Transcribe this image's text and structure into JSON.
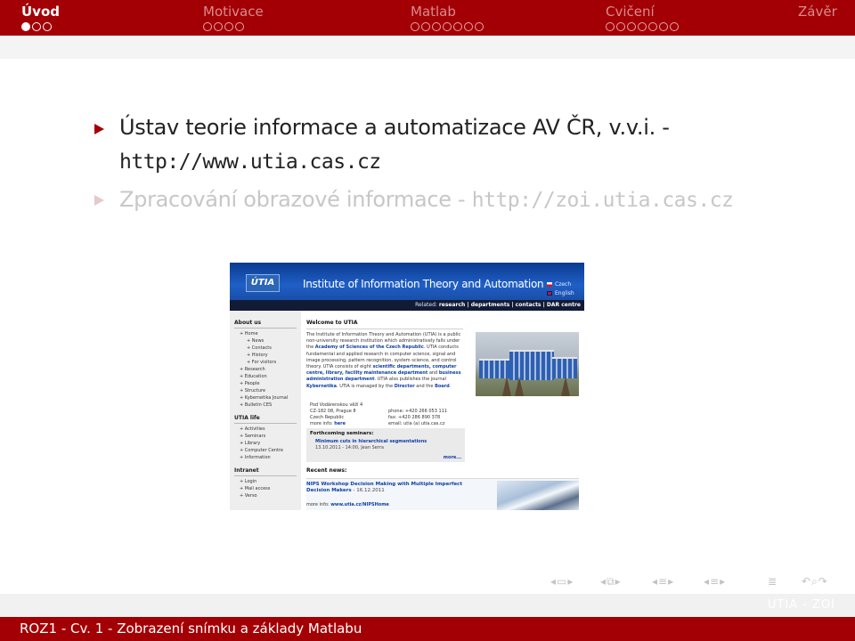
{
  "header": {
    "sections": [
      {
        "label": "Úvod",
        "dots_total": 3,
        "dots_filled": 1,
        "active": true
      },
      {
        "label": "Motivace",
        "dots_total": 4,
        "dots_filled": 0,
        "active": false
      },
      {
        "label": "Matlab",
        "dots_total": 7,
        "dots_filled": 0,
        "active": false
      },
      {
        "label": "Cvičení",
        "dots_total": 7,
        "dots_filled": 0,
        "active": false
      },
      {
        "label": "Závěr",
        "dots_total": 0,
        "dots_filled": 0,
        "active": false
      }
    ]
  },
  "slide": {
    "items": [
      {
        "text": "Ústav teorie informace a automatizace AV ČR, v.v.i. -",
        "url": "http://www.utia.cas.cz"
      },
      {
        "text": "Zpracování obrazové informace -",
        "url": "http://zoi.utia.cas.cz"
      }
    ]
  },
  "website": {
    "logo": "ÚTIA",
    "title": "Institute of Information Theory and Automation",
    "languages": [
      "Czech",
      "English"
    ],
    "related_prefix": "Related:",
    "related_links": "research | departments | contacts | DAR centre",
    "sidebar": {
      "about": {
        "heading": "About us",
        "links": [
          {
            "label": "+ Home",
            "level": "top"
          },
          {
            "label": "+ News",
            "level": "sub"
          },
          {
            "label": "+ Contacts",
            "level": "sub"
          },
          {
            "label": "+ History",
            "level": "sub"
          },
          {
            "label": "+ For visitors",
            "level": "sub"
          },
          {
            "label": "+ Research",
            "level": "top"
          },
          {
            "label": "+ Education",
            "level": "top"
          },
          {
            "label": "+ People",
            "level": "top"
          },
          {
            "label": "+ Structure",
            "level": "top"
          },
          {
            "label": "+ Kybernetika Journal",
            "level": "top"
          },
          {
            "label": "+ Bulletin CES",
            "level": "top"
          }
        ]
      },
      "life": {
        "heading": "UTIA life",
        "links": [
          {
            "label": "+ Activities",
            "level": "top"
          },
          {
            "label": "+ Seminars",
            "level": "top"
          },
          {
            "label": "+ Library",
            "level": "top"
          },
          {
            "label": "+ Computer Centre",
            "level": "top"
          },
          {
            "label": "+ Information",
            "level": "top"
          }
        ]
      },
      "intranet": {
        "heading": "Intranet",
        "links": [
          {
            "label": "+ Login",
            "level": "top"
          },
          {
            "label": "+ Mail access",
            "level": "top"
          },
          {
            "label": "+ Verso",
            "level": "top"
          }
        ]
      }
    },
    "welcome": "Welcome to UTIA",
    "intro_1": "The Institute of Information Theory and Automation (UTIA) is a public non-university research institution which administratively falls under the ",
    "intro_link_1": "Academy of Sciences of the Czech Republic",
    "intro_2": ". UTIA conducts fundamental and applied research in computer science, signal and image processing, pattern recognition, system science, and control theory. UTIA consists of eight ",
    "intro_link_2": "scientific departments, computer centre, library, facility maintenance department",
    "intro_3": " and ",
    "intro_link_3": "business administration department",
    "intro_4": ". UTIA also publishes the journal ",
    "intro_link_4": "Kybernetika",
    "intro_5": ". UTIA is managed by the ",
    "intro_link_5": "Director",
    "intro_6": " and the ",
    "intro_link_6": "Board",
    "intro_7": ".",
    "address": {
      "line1": "Pod Vodárenskou věží 4",
      "line2": "CZ-182 08, Prague 8",
      "line3": "Czech Republic",
      "more_prefix": "more info: ",
      "more_link": "here"
    },
    "contact": {
      "phone": "phone: +420 266 053 111",
      "fax": "fax: +420 286 890 378",
      "email": "email: utia (a) utia.cas.cz"
    },
    "seminars": {
      "heading": "Forthcoming seminars:",
      "item": "Minimum cuts in hierarchical segmentations",
      "date": "13.10.2011 - 14:00, Jean Serra",
      "more": "more..."
    },
    "news": {
      "heading": "Recent news:",
      "title": "NIPS Workshop Decision Making with Multiple Imperfect Decision Makers",
      "date": "- 16.12.2011",
      "more_prefix": "more info: ",
      "more_link": "www.utia.cz/NIPSHome"
    }
  },
  "footer": {
    "text": "ROZ1 - Cv. 1 - Zobrazení snímku a základy Matlabu",
    "right": "UTIA - ZOI"
  },
  "colors": {
    "accent": "#a30005",
    "inactive_nav": "#d98a8c"
  },
  "nav_symbols": [
    "slide-prev-icon",
    "slide-next-icon",
    "frame-prev-icon",
    "frame-next-icon",
    "section-prev-icon",
    "section-next-icon",
    "subsection-prev-icon",
    "subsection-next-icon",
    "align-icon",
    "search-back-icon",
    "search-icon",
    "search-forward-icon"
  ]
}
